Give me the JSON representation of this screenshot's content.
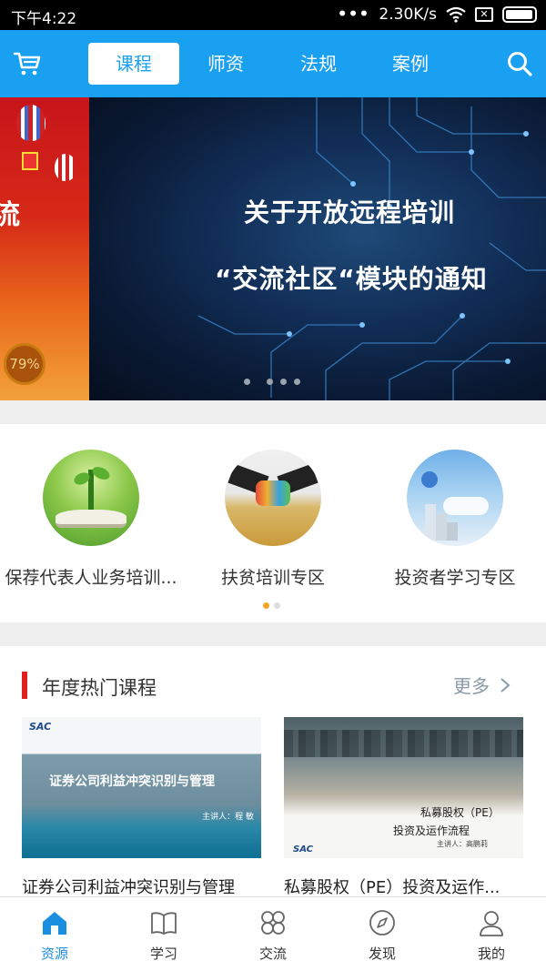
{
  "status_bar": {
    "time": "下午4:22",
    "network_speed": "2.30K/s",
    "dots": "•••"
  },
  "top_nav": {
    "tabs": [
      {
        "label": "课程",
        "active": true
      },
      {
        "label": "师资",
        "active": false
      },
      {
        "label": "法规",
        "active": false
      },
      {
        "label": "案例",
        "active": false
      }
    ],
    "accent_color": "#1aa0f0"
  },
  "banner": {
    "line1": "关于开放远程培训",
    "line2": "“交流社区“模块的通知",
    "left_partial_char": "流",
    "left_badge": "79%",
    "slide_count": 4
  },
  "categories": [
    {
      "label": "保荐代表人业务培训...",
      "icon": "plant-book-image"
    },
    {
      "label": "扶贫培训专区",
      "icon": "handshake-wheat-image"
    },
    {
      "label": "投资者学习专区",
      "icon": "stairs-sky-image"
    }
  ],
  "hot_courses": {
    "title": "年度热门课程",
    "more_label": "更多",
    "items": [
      {
        "name": "证券公司利益冲突识别与管理",
        "thumb_title": "证券公司利益冲突识别与管理",
        "thumb_lecturer": "主讲人：程 敏",
        "thumb_logo": "SAC"
      },
      {
        "name": "私募股权（PE）投资及运作...",
        "thumb_title_1": "私募股权（PE）",
        "thumb_title_2": "投资及运作流程",
        "thumb_lecturer": "主讲人：高鹏莉",
        "thumb_logo": "SAC"
      }
    ]
  },
  "tab_bar": {
    "items": [
      {
        "label": "资源",
        "icon": "home-icon",
        "active": true
      },
      {
        "label": "学习",
        "icon": "book-icon",
        "active": false
      },
      {
        "label": "交流",
        "icon": "grid-icon",
        "active": false
      },
      {
        "label": "发现",
        "icon": "compass-icon",
        "active": false
      },
      {
        "label": "我的",
        "icon": "user-icon",
        "active": false
      }
    ],
    "active_color": "#1a8fe0"
  }
}
